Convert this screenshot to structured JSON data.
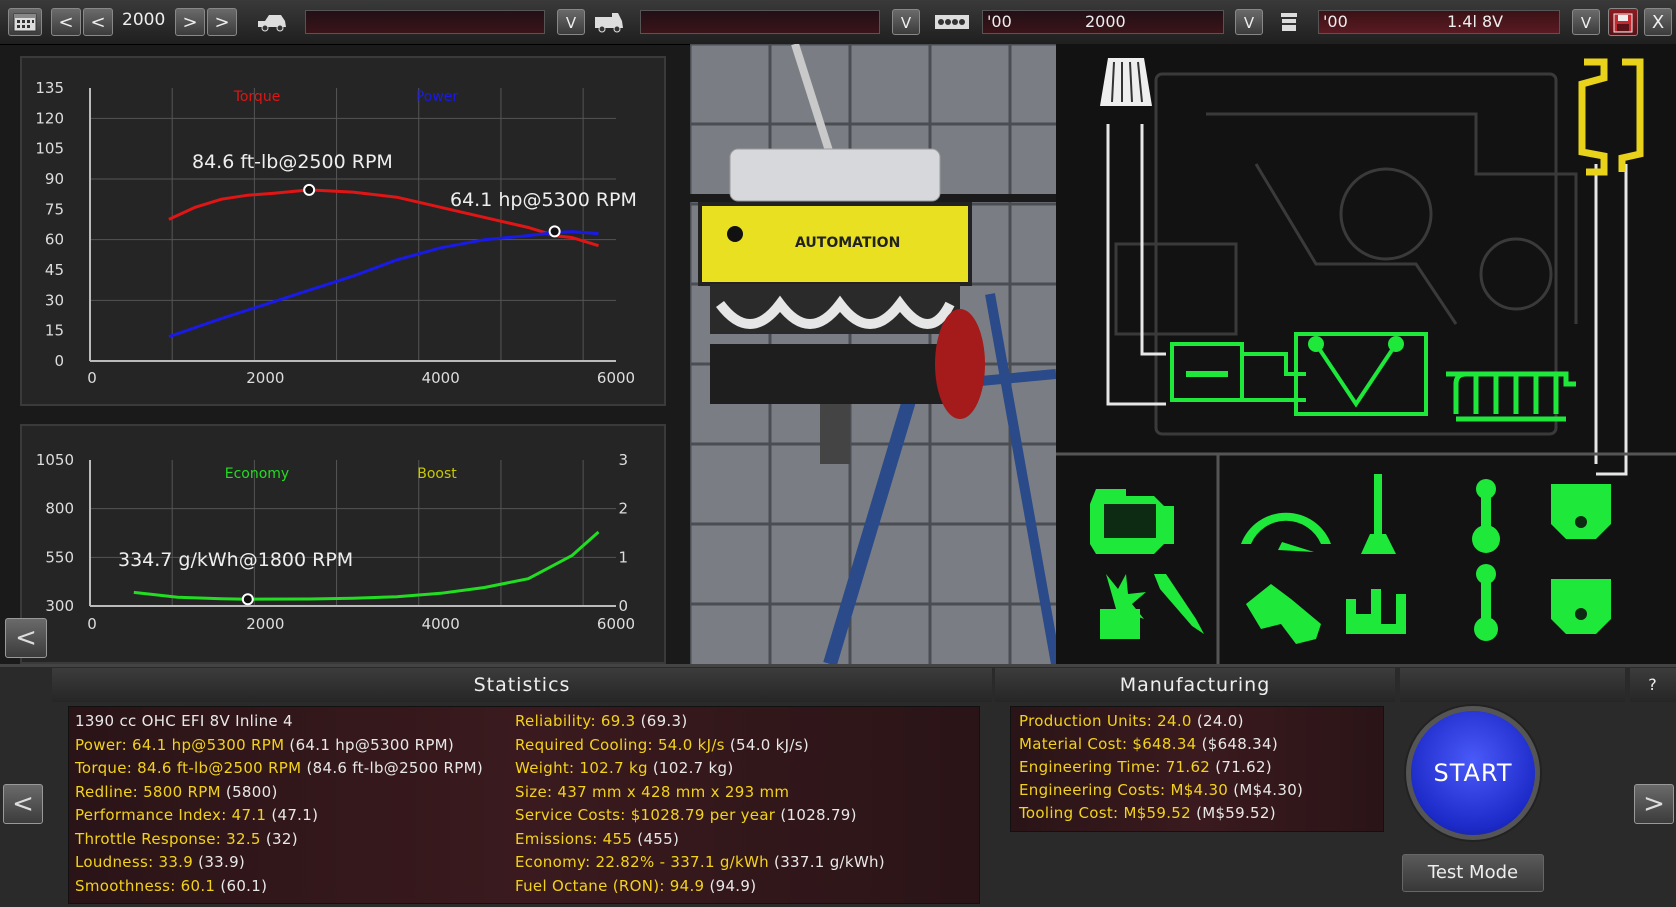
{
  "toolbar": {
    "year": "2000",
    "prev_far": "<",
    "prev": "<",
    "next": ">",
    "next_far": ">",
    "car_model_value": "",
    "car_trim_value": "",
    "engine_family_year": "'00",
    "engine_family_name": "2000",
    "engine_variant_year": "'00",
    "engine_variant_name": "1.4l 8V",
    "dropdown_label": "V",
    "close_label": "X"
  },
  "torque_chart": {
    "legend_torque": "Torque",
    "legend_power": "Power",
    "torque_annotation": "84.6 ft-lb@2500 RPM",
    "power_annotation": "64.1 hp@5300 RPM",
    "y_ticks": [
      "135",
      "120",
      "105",
      "90",
      "75",
      "60",
      "45",
      "30",
      "15",
      "0"
    ],
    "x_ticks": [
      "0",
      "2000",
      "4000",
      "6000"
    ]
  },
  "economy_chart": {
    "legend_economy": "Economy",
    "legend_boost": "Boost",
    "economy_annotation": "334.7 g/kWh@1800 RPM",
    "y_ticks_left": [
      "1050",
      "800",
      "550",
      "300"
    ],
    "y_ticks_right": [
      "3",
      "2",
      "1",
      "0"
    ],
    "x_ticks": [
      "0",
      "2000",
      "4000",
      "6000"
    ]
  },
  "chart_data": [
    {
      "type": "line",
      "title": "",
      "xlabel": "",
      "ylabel": "",
      "xlim": [
        0,
        6000
      ],
      "ylim": [
        0,
        135
      ],
      "legend": [
        "Torque",
        "Power"
      ],
      "series": [
        {
          "name": "Torque",
          "color": "#e01515",
          "x": [
            900,
            1200,
            1500,
            1800,
            2100,
            2500,
            3000,
            3500,
            4000,
            4500,
            5000,
            5300,
            5500,
            5800
          ],
          "y": [
            70,
            76,
            80,
            82,
            83,
            84.6,
            83.5,
            81,
            76,
            71,
            66,
            62,
            61,
            57
          ]
        },
        {
          "name": "Power",
          "color": "#1a1ae6",
          "x": [
            900,
            1500,
            2000,
            2500,
            3000,
            3500,
            4000,
            4500,
            5000,
            5300,
            5500,
            5800
          ],
          "y": [
            12,
            21,
            28,
            35,
            42,
            50,
            56,
            60,
            62,
            63.5,
            64,
            63
          ]
        }
      ],
      "annotations": [
        {
          "text": "84.6 ft-lb@2500 RPM",
          "x": 2500,
          "y": 84.6
        },
        {
          "text": "64.1 hp@5300 RPM",
          "x": 5300,
          "y": 64.1
        }
      ]
    },
    {
      "type": "line",
      "title": "",
      "xlim": [
        0,
        6000
      ],
      "ylim": [
        300,
        1050
      ],
      "y2lim": [
        0,
        3
      ],
      "legend": [
        "Economy",
        "Boost"
      ],
      "series": [
        {
          "name": "Economy",
          "color": "#22dd22",
          "x": [
            500,
            1000,
            1500,
            1800,
            2500,
            3000,
            3500,
            4000,
            4500,
            5000,
            5500,
            5800
          ],
          "y": [
            370,
            345,
            337,
            335,
            336,
            340,
            348,
            365,
            395,
            440,
            560,
            680
          ]
        }
      ],
      "annotations": [
        {
          "text": "334.7 g/kWh@1800 RPM",
          "x": 1800,
          "y": 334.7
        }
      ]
    }
  ],
  "engine_view": {
    "brand_text": "AUTOMATION"
  },
  "statistics": {
    "header": "Statistics",
    "left": [
      {
        "k": "1390 cc OHC EFI 8V Inline 4",
        "v": "",
        "plain": true
      },
      {
        "k": "Power: 64.1 hp@5300 RPM",
        "v": " (64.1 hp@5300 RPM)"
      },
      {
        "k": "Torque: 84.6 ft-lb@2500 RPM",
        "v": " (84.6 ft-lb@2500 RPM)"
      },
      {
        "k": "Redline: 5800 RPM",
        "v": " (5800)"
      },
      {
        "k": "Performance Index: 47.1",
        "v": " (47.1)"
      },
      {
        "k": "Throttle Response: 32.5",
        "v": " (32)"
      },
      {
        "k": "Loudness: 33.9",
        "v": " (33.9)"
      },
      {
        "k": "Smoothness: 60.1",
        "v": " (60.1)"
      }
    ],
    "right": [
      {
        "k": "Reliability: 69.3",
        "v": " (69.3)"
      },
      {
        "k": "Required Cooling: 54.0 kJ/s",
        "v": " (54.0 kJ/s)"
      },
      {
        "k": "Weight: 102.7 kg",
        "v": " (102.7 kg)"
      },
      {
        "k": "Size: 437 mm x 428 mm x 293 mm",
        "v": ""
      },
      {
        "k": "Service Costs: $1028.79 per year",
        "v": " (1028.79)"
      },
      {
        "k": "Emissions: 455",
        "v": " (455)"
      },
      {
        "k": "Economy: 22.82% - 337.1 g/kWh",
        "v": " (337.1 g/kWh)"
      },
      {
        "k": "Fuel Octane (RON): 94.9",
        "v": " (94.9)"
      }
    ]
  },
  "manufacturing": {
    "header": "Manufacturing",
    "items": [
      {
        "k": "Production Units: 24.0",
        "v": " (24.0)"
      },
      {
        "k": "Material Cost: $648.34",
        "v": " ($648.34)"
      },
      {
        "k": "Engineering Time: 71.62",
        "v": " (71.62)"
      },
      {
        "k": "Engineering Costs: M$4.30",
        "v": " (M$4.30)"
      },
      {
        "k": "Tooling Cost: M$59.52",
        "v": " (M$59.52)"
      }
    ]
  },
  "actions": {
    "start_label": "START",
    "test_mode_label": "Test Mode",
    "help_label": "?",
    "back_label": "<",
    "prev_label": "<",
    "next_label": ">"
  },
  "colors": {
    "accent_yellow": "#f2d21c",
    "torque_red": "#e01515",
    "power_blue": "#1a1ae6",
    "economy_green": "#22dd22",
    "boost_yellow": "#c8c800",
    "schematic_green": "#1ee83a",
    "start_blue": "#2b3ee6"
  }
}
